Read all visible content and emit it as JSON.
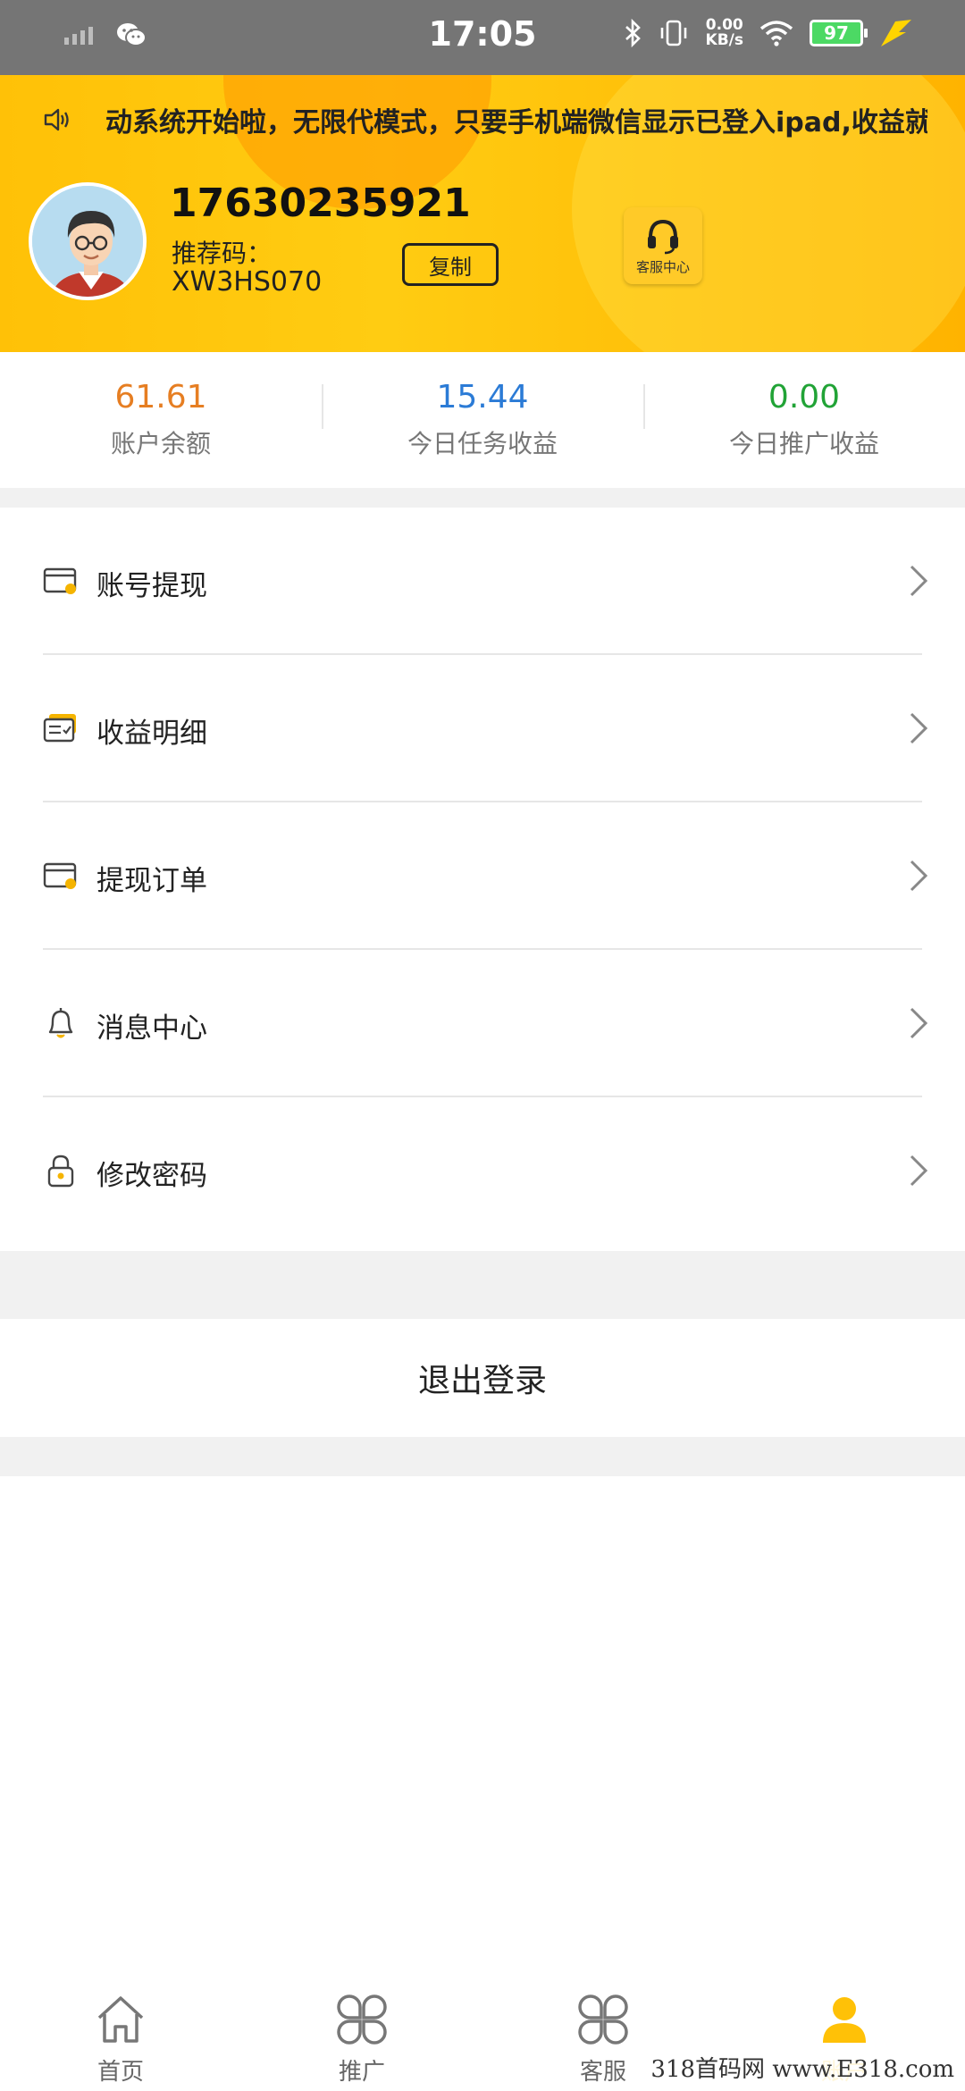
{
  "status_bar": {
    "time": "17:05",
    "net_speed_value": "0.00",
    "net_speed_unit": "KB/s",
    "battery": "97"
  },
  "notice": {
    "text": "动系统开始啦，无限代模式，只要手机端微信显示已登入ipad,收益就"
  },
  "profile": {
    "phone": "17630235921",
    "ref_label": "推荐码：",
    "ref_code": "XW3HS070",
    "copy_label": "复制",
    "cs_label": "客服中心"
  },
  "stats": [
    {
      "value": "61.61",
      "label": "账户余额",
      "color": "#e67e22"
    },
    {
      "value": "15.44",
      "label": "今日任务收益",
      "color": "#2b7bd6"
    },
    {
      "value": "0.00",
      "label": "今日推广收益",
      "color": "#21a336"
    }
  ],
  "menu": [
    {
      "label": "账号提现",
      "icon": "wallet-icon"
    },
    {
      "label": "收益明细",
      "icon": "ledger-icon"
    },
    {
      "label": "提现订单",
      "icon": "order-icon"
    },
    {
      "label": "消息中心",
      "icon": "bell-icon"
    },
    {
      "label": "修改密码",
      "icon": "lock-icon"
    }
  ],
  "logout_label": "退出登录",
  "nav": [
    {
      "label": "首页",
      "icon": "home-icon"
    },
    {
      "label": "推广",
      "icon": "promote-icon"
    },
    {
      "label": "客服",
      "icon": "service-icon"
    },
    {
      "label": "账户",
      "icon": "account-icon",
      "active": true
    }
  ],
  "colors": {
    "accent": "#ffc107",
    "status_bar": "#757575"
  },
  "watermark": "318首码网 www.E318.com"
}
